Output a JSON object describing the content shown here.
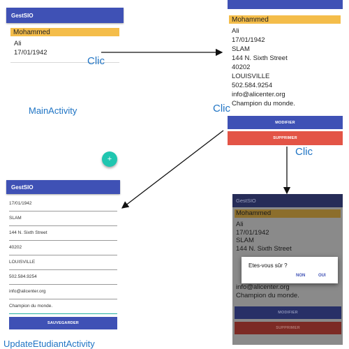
{
  "main_activity": {
    "appbar_title": "GestSIO",
    "student": {
      "firstname": "Mohammed",
      "lastname": "Ali",
      "birthdate": "17/01/1942"
    },
    "caption": "MainActivity",
    "fab_label": "+"
  },
  "detail_activity": {
    "firstname": "Mohammed",
    "lines": [
      "Ali",
      "17/01/1942",
      "SLAM",
      "144 N. Sixth Street",
      "40202",
      "LOUISVILLE",
      "502.584.9254",
      "info@alicenter.org",
      "Champion du monde."
    ],
    "modify_label": "MODIFIER",
    "delete_label": "SUPPRIMER"
  },
  "update_activity": {
    "appbar_title": "GestSIO",
    "fields": [
      "17/01/1942",
      "SLAM",
      "144 N. Sixth Street",
      "40202",
      "LOUISVILLE",
      "502.584.9254",
      "info@alicenter.org",
      "Champion du monde."
    ],
    "save_label": "SAUVEGARDER",
    "caption": "UpdateEtudiantActivity"
  },
  "dialog_screen": {
    "appbar_title": "GestSIO",
    "firstname": "Mohammed",
    "lines": [
      "Ali",
      "17/01/1942",
      "SLAM",
      "144 N. Sixth Street"
    ],
    "lines_after": [
      "info@alicenter.org",
      "Champion du monde."
    ],
    "dialog_title": "Etes-vous sûr ?",
    "dialog_no": "NON",
    "dialog_yes": "OUI",
    "modify_label": "MODIFIER",
    "delete_label": "SUPPRIMER"
  },
  "annotations": {
    "clic_1": "Clic",
    "clic_2": "Clic",
    "clic_3": "Clic"
  },
  "colors": {
    "primary": "#3f51b5",
    "accent_highlight": "#f4bd4a",
    "delete_red": "#e35446",
    "fab_teal": "#20c6b0",
    "caption_blue": "#1f74c4"
  }
}
